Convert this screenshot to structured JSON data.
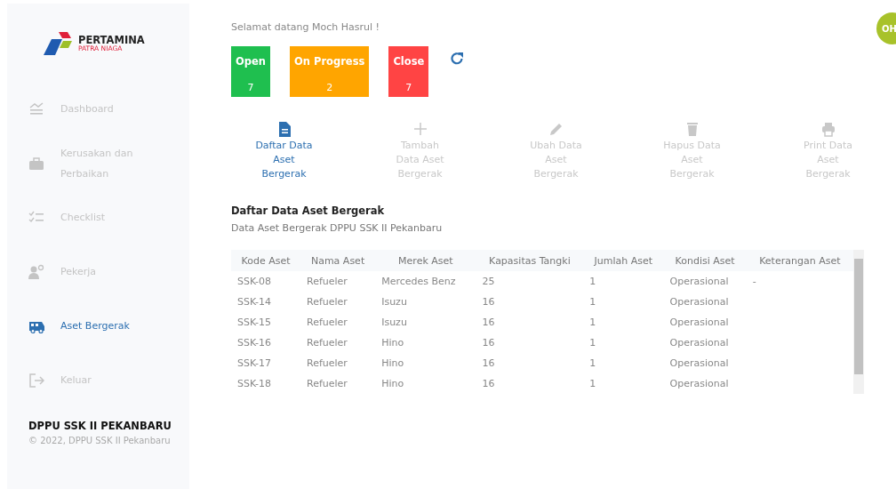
{
  "sidebar": {
    "logo": {
      "title": "PERTAMINA",
      "subtitle": "PATRA NIAGA"
    },
    "items": [
      {
        "kind": "dashboard",
        "label": "Dashboard",
        "selected": false
      },
      {
        "kind": "toolbox",
        "label": "Kerusakan dan Perbaikan",
        "selected": false
      },
      {
        "kind": "checklist",
        "label": "Checklist",
        "selected": false
      },
      {
        "kind": "workers",
        "label": "Pekerja",
        "selected": false
      },
      {
        "kind": "bus",
        "label": "Aset Bergerak",
        "selected": true
      },
      {
        "kind": "logout",
        "label": "Keluar",
        "selected": false
      }
    ],
    "footer": {
      "title": "DPPU SSK II PEKANBARU",
      "copyright": "© 2022, DPPU SSK II Pekanbaru"
    }
  },
  "greeting": "Selamat datang Moch Hasrul !",
  "avatar": {
    "initials": "OH"
  },
  "status_cards": [
    {
      "label": "Open",
      "count": "7",
      "color": "#1fbf4f"
    },
    {
      "label": "On Progress",
      "count": "2",
      "color": "#ffa500"
    },
    {
      "label": "Close",
      "count": "7",
      "color": "#ff4444"
    }
  ],
  "actions": [
    {
      "kind": "list",
      "label": "Daftar Data Aset Bergerak",
      "selected": true
    },
    {
      "kind": "add",
      "label": "Tambah Data Aset Bergerak",
      "selected": false
    },
    {
      "kind": "edit",
      "label": "Ubah Data Aset Bergerak",
      "selected": false
    },
    {
      "kind": "delete",
      "label": "Hapus Data Aset Bergerak",
      "selected": false
    },
    {
      "kind": "print",
      "label": "Print Data Aset Bergerak",
      "selected": false
    }
  ],
  "section": {
    "title": "Daftar Data Aset Bergerak",
    "subtitle": "Data Aset Bergerak DPPU SSK II Pekanbaru"
  },
  "table": {
    "columns": [
      "Kode Aset",
      "Nama Aset",
      "Merek Aset",
      "Kapasitas Tangki",
      "Jumlah Aset",
      "Kondisi Aset",
      "Keterangan Aset"
    ],
    "rows": [
      [
        "SSK-08",
        "Refueler",
        "Mercedes Benz",
        "25",
        "1",
        "Operasional",
        "-"
      ],
      [
        "SSK-14",
        "Refueler",
        "Isuzu",
        "16",
        "1",
        "Operasional",
        ""
      ],
      [
        "SSK-15",
        "Refueler",
        "Isuzu",
        "16",
        "1",
        "Operasional",
        ""
      ],
      [
        "SSK-16",
        "Refueler",
        "Hino",
        "16",
        "1",
        "Operasional",
        ""
      ],
      [
        "SSK-17",
        "Refueler",
        "Hino",
        "16",
        "1",
        "Operasional",
        ""
      ],
      [
        "SSK-18",
        "Refueler",
        "Hino",
        "16",
        "1",
        "Operasional",
        ""
      ]
    ]
  }
}
